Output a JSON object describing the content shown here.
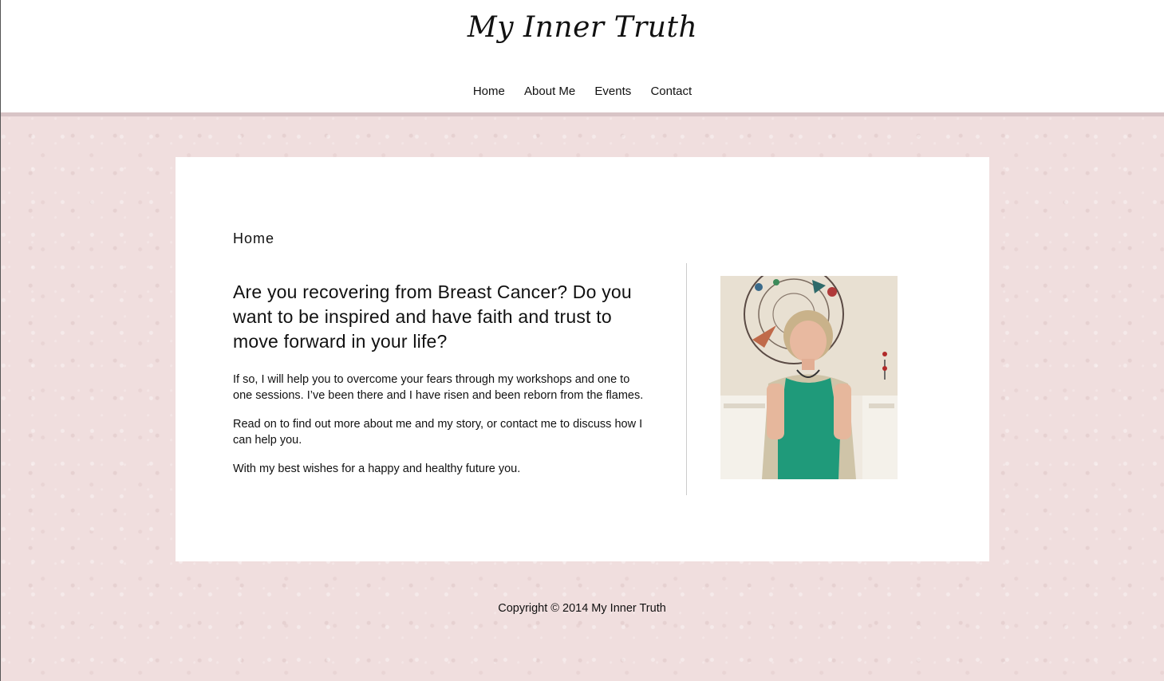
{
  "header": {
    "site_title": "My Inner Truth",
    "nav": [
      {
        "label": "Home"
      },
      {
        "label": "About Me"
      },
      {
        "label": "Events"
      },
      {
        "label": "Contact"
      }
    ]
  },
  "main": {
    "page_heading": "Home",
    "lead": "Are you recovering from Breast Cancer? Do you want to be inspired and have faith and trust to move forward in your life?",
    "paragraphs": [
      "If so, I will help you to overcome your fears through my workshops and one to one sessions. I’ve been there and I have risen and been reborn from the flames.",
      "Read on to find out more about me and my story, or contact me to discuss how I can help you.",
      "With my best wishes for a happy and healthy future you."
    ],
    "image_icon": "portrait-photo"
  },
  "footer": {
    "copyright": "Copyright © 2014 My Inner Truth"
  },
  "colors": {
    "background": "#f0dede",
    "header_rule": "#d8c4c6",
    "card": "#ffffff",
    "text": "#111111"
  }
}
